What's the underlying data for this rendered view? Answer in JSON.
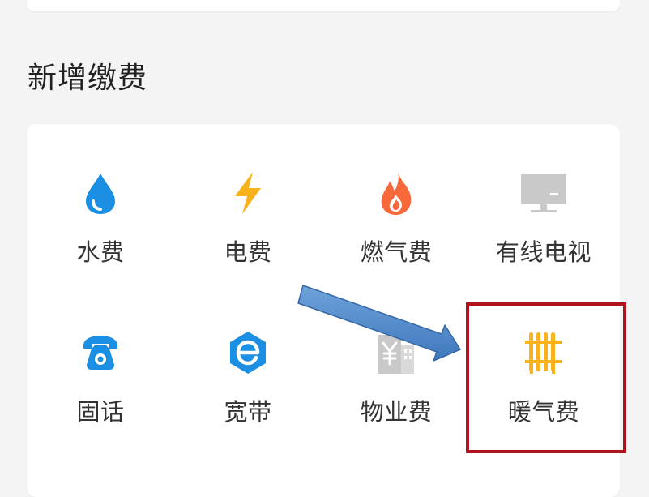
{
  "section": {
    "title": "新增缴费"
  },
  "services": [
    {
      "label": "水费",
      "icon": "water-drop-icon",
      "color": "#1a8fe3"
    },
    {
      "label": "电费",
      "icon": "lightning-icon",
      "color": "#f8b31c"
    },
    {
      "label": "燃气费",
      "icon": "flame-icon",
      "color": "#f7683a"
    },
    {
      "label": "有线电视",
      "icon": "tv-icon",
      "color": "#c9c9c9"
    },
    {
      "label": "固话",
      "icon": "telephone-icon",
      "color": "#1a8fe3"
    },
    {
      "label": "宽带",
      "icon": "broadband-e-icon",
      "color": "#1a8fe3"
    },
    {
      "label": "物业费",
      "icon": "building-yen-icon",
      "color": "#c9c9c9"
    },
    {
      "label": "暖气费",
      "icon": "radiator-icon",
      "color": "#f8b31c"
    }
  ],
  "annotation": {
    "arrow_color": "#4a86c8",
    "highlight_color": "#b2101a",
    "highlighted_item": "暖气费"
  }
}
